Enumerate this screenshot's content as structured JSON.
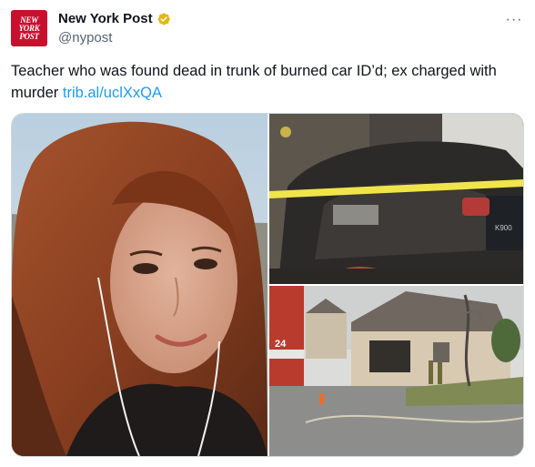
{
  "account": {
    "display_name": "New York Post",
    "handle": "@nypost",
    "avatar_lines": [
      "NEW",
      "YORK",
      "POST"
    ],
    "verified_color": "#e2b719"
  },
  "more_label": "···",
  "tweet": {
    "text": "Teacher who was found dead in trunk of burned car ID’d; ex charged with murder",
    "link": "trib.al/uclXxQA"
  },
  "media": {
    "images": [
      {
        "name": "woman-selfie-photo"
      },
      {
        "name": "burned-car-photo",
        "plate_text": "K900"
      },
      {
        "name": "house-fire-scene-photo",
        "truck_number": "24"
      }
    ]
  },
  "colors": {
    "link": "#1d9bf0",
    "text": "#0f1419",
    "secondary": "#536471",
    "brand": "#c8102e"
  }
}
